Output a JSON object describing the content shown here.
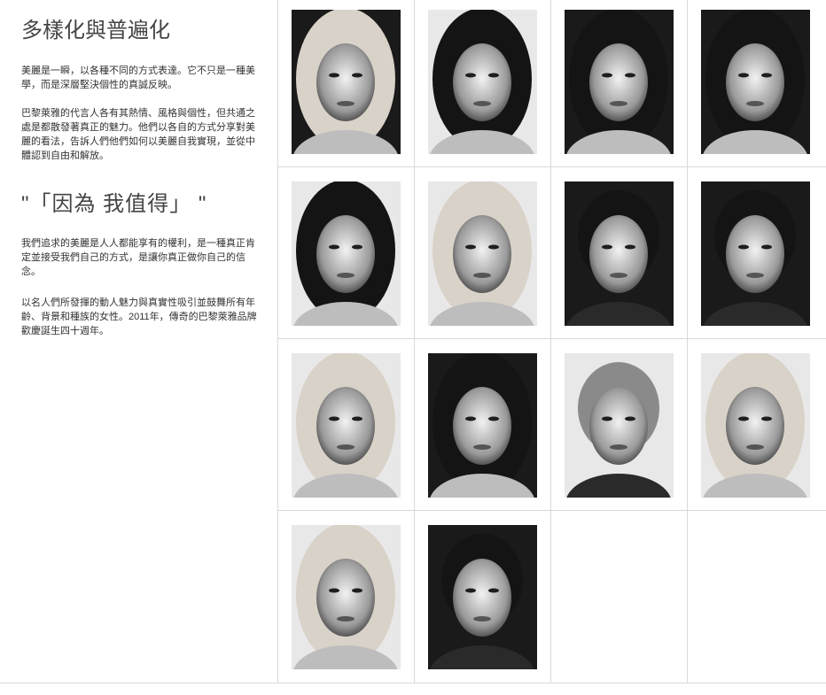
{
  "intro": {
    "heading": "多樣化與普遍化",
    "paragraph1": "美麗是一瞬，以各種不同的方式表達。它不只是一種美學，而是深層堅決個性的真誠反映。",
    "paragraph2": "巴黎萊雅的代言人各有其熱情、風格與個性，但共通之處是都散發著真正的魅力。他們以各自的方式分享對美麗的看法，告訴人們他們如何以美麗自我實現，並從中體認到自由和解放。",
    "slogan": "\"「因為 我值得」 \"",
    "paragraph3": "我們追求的美麗是人人都能享有的權利，是一種真正肯定並接受我們自己的方式，是讓你真正做你自己的信念。",
    "paragraph4": "以名人們所發揮的動人魅力與真實性吸引並鼓舞所有年齡、背景和種族的女性。2011年，傳奇的巴黎萊雅品牌歡慶誕生四十週年。"
  },
  "gallery": {
    "portraits": [
      {
        "hair": "light",
        "bg": "dark",
        "face": "female"
      },
      {
        "hair": "dark",
        "bg": "light",
        "face": "female"
      },
      {
        "hair": "dark",
        "bg": "dark",
        "face": "female"
      },
      {
        "hair": "dark",
        "bg": "dark",
        "face": "female"
      },
      {
        "hair": "dark",
        "bg": "light",
        "face": "female"
      },
      {
        "hair": "light",
        "bg": "light",
        "face": "female"
      },
      {
        "hair": "dark",
        "bg": "dark",
        "face": "male"
      },
      {
        "hair": "dark",
        "bg": "dark",
        "face": "male"
      },
      {
        "hair": "light",
        "bg": "light",
        "face": "female"
      },
      {
        "hair": "dark",
        "bg": "dark",
        "face": "female"
      },
      {
        "hair": "grey",
        "bg": "light",
        "face": "male"
      },
      {
        "hair": "light",
        "bg": "light",
        "face": "female"
      },
      {
        "hair": "light",
        "bg": "light",
        "face": "female"
      },
      {
        "hair": "dark",
        "bg": "dark",
        "face": "male"
      }
    ]
  },
  "colors": {
    "divider": "#d8d8d8",
    "heading": "#444444",
    "text": "#333333"
  }
}
